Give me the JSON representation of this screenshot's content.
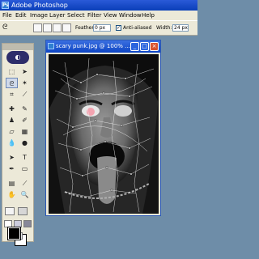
{
  "app": {
    "title": "Adobe Photoshop"
  },
  "menu": [
    "File",
    "Edit",
    "Image",
    "Layer",
    "Select",
    "Filter",
    "View",
    "Window",
    "Help"
  ],
  "options": {
    "feather_label": "Feather:",
    "feather_value": "0 px",
    "antialiased_label": "Anti-aliased",
    "antialiased_checked": true,
    "width_label": "Width:",
    "width_value": "24 px"
  },
  "document": {
    "title": "scary punk.jpg @ 100% ..."
  },
  "colors": {
    "foreground": "#000000",
    "background": "#ffffff",
    "accent": "#0a3fb8"
  }
}
